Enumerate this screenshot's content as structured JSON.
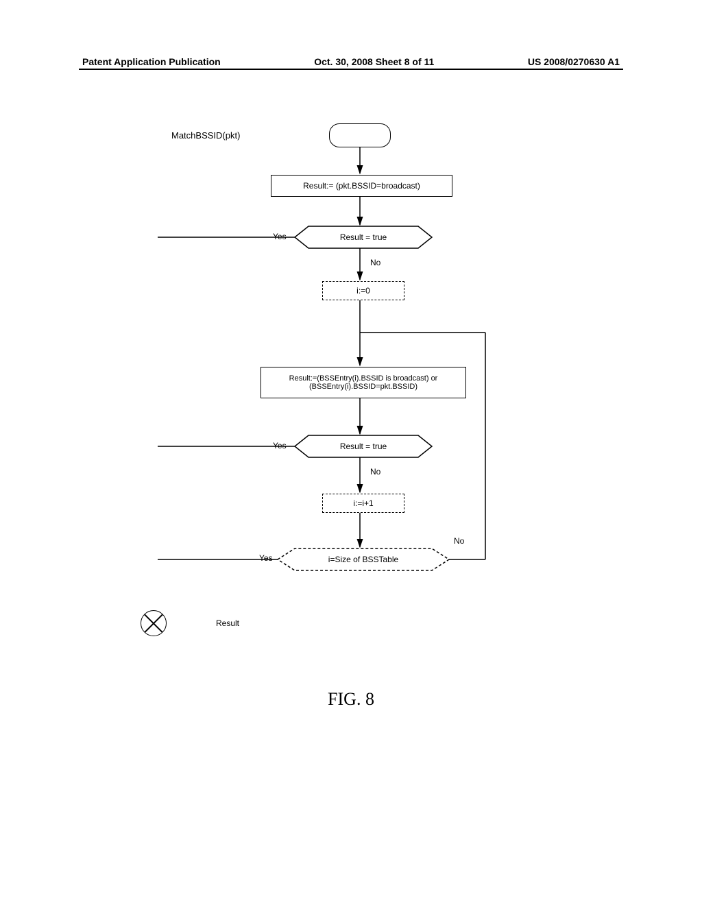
{
  "header": {
    "left": "Patent Application Publication",
    "center": "Oct. 30, 2008  Sheet 8 of 11",
    "right": "US 2008/0270630 A1"
  },
  "diagram": {
    "function_name": "MatchBSSID(pkt)",
    "step_result1": "Result:= (pkt.BSSID=broadcast)",
    "decision1": "Result = true",
    "yes1": "Yes",
    "no1": "No",
    "step_init": "i:=0",
    "step_result2": "Result:=(BSSEntry(i).BSSID is broadcast) or (BSSEntry(i).BSSID=pkt.BSSID)",
    "decision2": "Result = true",
    "yes2": "Yes",
    "no2": "No",
    "step_incr": "i:=i+1",
    "decision3": "i=Size of BSSTable",
    "yes3": "Yes",
    "no3": "No",
    "result_label": "Result",
    "caption": "FIG. 8"
  }
}
